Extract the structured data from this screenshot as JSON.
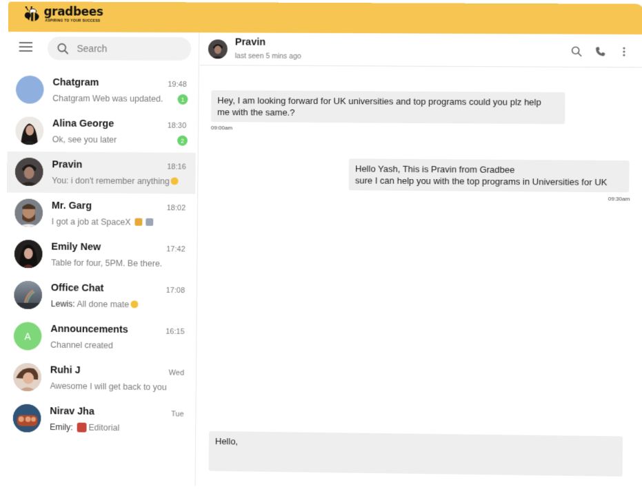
{
  "brand": {
    "name": "gradbees",
    "tagline": "ASPIRING TO YOUR SUCCESS",
    "bar_color": "#f7c552"
  },
  "sidebar": {
    "menu_icon": "hamburger-icon",
    "search": {
      "placeholder": "Search",
      "icon": "search-icon"
    },
    "chats": [
      {
        "name": "Chatgram",
        "time": "19:48",
        "sender": "",
        "preview": "Chatgram Web was updated.",
        "badge": "1",
        "avatar": "chatgram-avatar"
      },
      {
        "name": "Alina George",
        "time": "18:30",
        "sender": "",
        "preview": "Ok, see you later",
        "badge": "2",
        "avatar": "alina-avatar"
      },
      {
        "name": "Pravin",
        "time": "18:16",
        "sender": "",
        "preview": "You: i don't remember anything",
        "badge": "",
        "avatar": "pravin-avatar",
        "active": true
      },
      {
        "name": "Mr. Garg",
        "time": "18:02",
        "sender": "",
        "preview": "I got a job at SpaceX",
        "badge": "",
        "avatar": "garg-avatar"
      },
      {
        "name": "Emily New",
        "time": "17:42",
        "sender": "",
        "preview": "Table for four, 5PM. Be there.",
        "badge": "",
        "avatar": "emily-avatar"
      },
      {
        "name": "Office Chat",
        "time": "17:08",
        "sender": "Lewis:",
        "preview": "All done mate",
        "badge": "",
        "avatar": "office-avatar"
      },
      {
        "name": "Announcements",
        "time": "16:15",
        "sender": "",
        "preview": "Channel created",
        "badge": "",
        "avatar": "announcements-avatar",
        "initial": "A"
      },
      {
        "name": "Ruhi J",
        "time": "Wed",
        "sender": "",
        "preview": "Awesome I will get back to you",
        "badge": "",
        "avatar": "ruhi-avatar"
      },
      {
        "name": "Nirav Jha",
        "time": "Tue",
        "sender": "Emily:",
        "preview": "Editorial",
        "badge": "",
        "avatar": "nirav-avatar"
      }
    ],
    "badge_color": "#6ad36d"
  },
  "conversation": {
    "contact": "Pravin",
    "status": "last seen 5 mins ago",
    "actions": [
      "search-icon",
      "phone-icon",
      "more-icon"
    ],
    "messages": [
      {
        "text_line1": "Hey, I am looking forward for UK universities and top programs could you plz help",
        "text_line2": "me with the same.?",
        "time": "09:00am",
        "direction": "incoming"
      },
      {
        "text_line1": "Hello Yash, This is Pravin from Gradbee",
        "text_line2": "sure I can help you with the top programs in Universities for UK",
        "time": "09:30am",
        "direction": "outgoing"
      }
    ],
    "composer_value": "Hello,"
  }
}
